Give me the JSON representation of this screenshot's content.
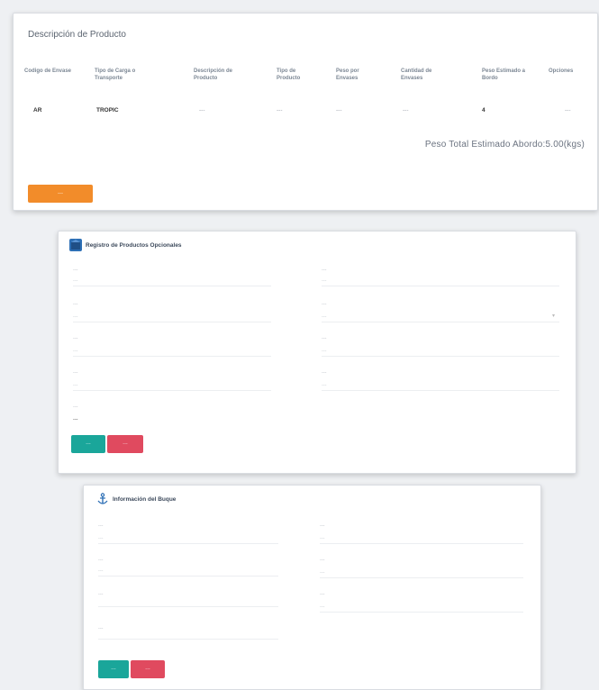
{
  "product": {
    "title": "Descripción de Producto",
    "columns": [
      "Codigo de Envase",
      "Tipo de Carga o Transporte",
      "Descripción de Producto",
      "Tipo de Producto",
      "Peso por Envases",
      "Cantidad de Envases",
      "Peso Estimado a Bordo",
      "Opciones"
    ],
    "row": [
      "AR",
      "TROPIC",
      "---",
      "---",
      "---",
      "---",
      "4",
      "---"
    ],
    "total_label": "Peso Total Estimado Abordo:",
    "total_value": "5.00(kgs)",
    "button_label": "---"
  },
  "register": {
    "title": "Registro de Productos Opcionales",
    "left_fields": [
      {
        "label": "---",
        "value": "---"
      },
      {
        "label": "---",
        "value": "---"
      },
      {
        "label": "---",
        "value": "---"
      },
      {
        "label": "---",
        "value": "---"
      },
      {
        "label": "---",
        "value": "---"
      }
    ],
    "right_fields": [
      {
        "label": "---",
        "value": "---"
      },
      {
        "label": "---",
        "value": "---"
      },
      {
        "label": "---",
        "value": "---"
      },
      {
        "label": "---",
        "value": "---"
      }
    ],
    "save_label": "---",
    "cancel_label": "---"
  },
  "ship": {
    "title": "Información del Buque",
    "left_fields": [
      {
        "label": "---",
        "value": "---"
      },
      {
        "label": "---",
        "value": "---"
      },
      {
        "label": "---",
        "value": ""
      },
      {
        "label": "---",
        "value": ""
      }
    ],
    "right_fields": [
      {
        "label": "---",
        "value": "---"
      },
      {
        "label": "---",
        "value": "---"
      },
      {
        "label": "---",
        "value": "---"
      }
    ],
    "save_label": "---",
    "cancel_label": "---"
  },
  "colors": {
    "accent_orange": "#f28c2a",
    "save_teal": "#1aa69a",
    "cancel_red": "#e04a5f",
    "header_blue": "#2d6fb5"
  },
  "icons": {
    "register_icon": "box-icon",
    "ship_icon": "anchor-icon"
  }
}
